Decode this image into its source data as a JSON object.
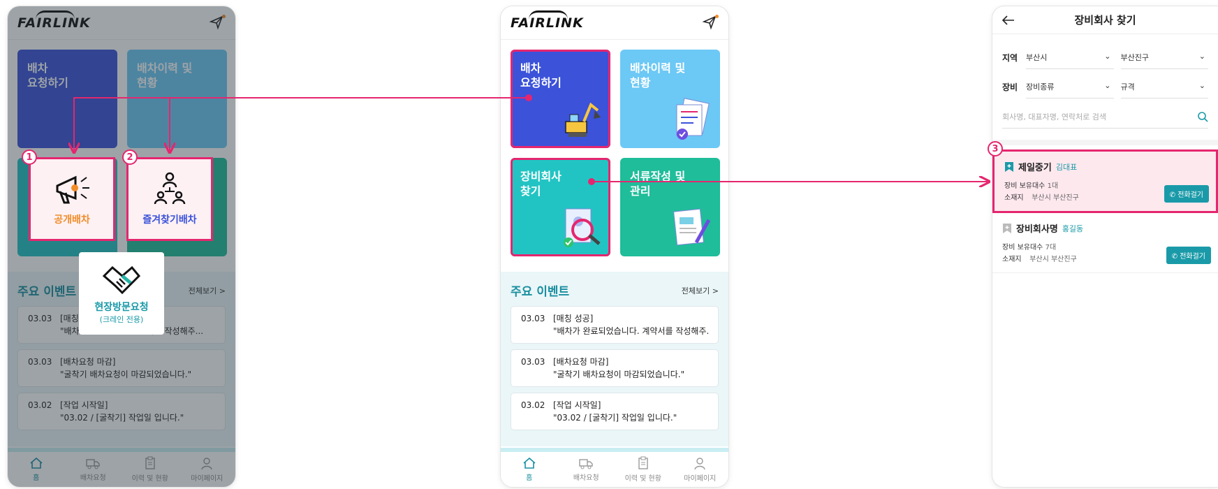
{
  "left_phone": {
    "logo": "FAIRLINK",
    "tiles": [
      {
        "label": "배차\n요청하기"
      },
      {
        "label": "배차이력 및\n현황"
      },
      {
        "label": ""
      },
      {
        "label": ""
      }
    ],
    "events_title": "주요 이벤트",
    "events_all": "전체보기 >",
    "events": [
      {
        "date": "03.03",
        "line1": "[매칭",
        "line2": "\"배차",
        "line2_tail": "서를 작성해주..."
      },
      {
        "date": "03.03",
        "line1": "[배차요청 마감]",
        "line2": "\"굴착기 배차요청이 마감되었습니다.\""
      },
      {
        "date": "03.02",
        "line1": "[작업 시작일]",
        "line2": "\"03.02 / [굴착기] 작업일 입니다.\""
      }
    ],
    "popups": {
      "open_label": "공개배차",
      "fav_label": "즐겨찾기배차",
      "visit_label": "현장방문요청",
      "visit_sub": "(크레인 전용)"
    },
    "badge1": "1",
    "badge2": "2"
  },
  "mid_phone": {
    "logo": "FAIRLINK",
    "tiles": [
      {
        "label": "배차\n요청하기"
      },
      {
        "label": "배차이력 및\n현황"
      },
      {
        "label": "장비회사\n찾기"
      },
      {
        "label": "서류작성 및\n관리"
      }
    ],
    "events_title": "주요 이벤트",
    "events_all": "전체보기 >",
    "events": [
      {
        "date": "03.03",
        "line1": "[매칭 성공]",
        "line2": "\"배차가 완료되었습니다. 계약서를 작성해주..."
      },
      {
        "date": "03.03",
        "line1": "[배차요청 마감]",
        "line2": "\"굴착기 배차요청이 마감되었습니다.\""
      },
      {
        "date": "03.02",
        "line1": "[작업 시작일]",
        "line2": "\"03.02 / [굴착기] 작업일 입니다.\""
      }
    ]
  },
  "nav": [
    {
      "label": "홈",
      "icon": "home-icon"
    },
    {
      "label": "배차요청",
      "icon": "truck-icon"
    },
    {
      "label": "이력 및 현황",
      "icon": "clipboard-icon"
    },
    {
      "label": "마이페이지",
      "icon": "user-icon"
    }
  ],
  "right_phone": {
    "title": "장비회사 찾기",
    "region_label": "지역",
    "region_city": "부산시",
    "region_district": "부산진구",
    "equip_label": "장비",
    "equip_type": "장비종류",
    "equip_spec": "규격",
    "search_placeholder": "회사명, 대표자명, 연락처로 검색",
    "badge3": "3",
    "companies": [
      {
        "name": "제일중기",
        "rep": "김대표",
        "count_label": "장비 보유대수",
        "count": "1대",
        "loc_label": "소재지",
        "loc": "부산시 부산진구",
        "call": "전화걸기"
      },
      {
        "name": "장비회사명",
        "rep": "홍길동",
        "count_label": "장비 보유대수",
        "count": "7대",
        "loc_label": "소재지",
        "loc": "부산시 부산진구",
        "call": "전화걸기"
      }
    ]
  },
  "colors": {
    "accent": "#e5266f",
    "teal": "#1a9aa8",
    "blue_tile": "#3b52d9",
    "sky_tile": "#6cc8f5"
  }
}
